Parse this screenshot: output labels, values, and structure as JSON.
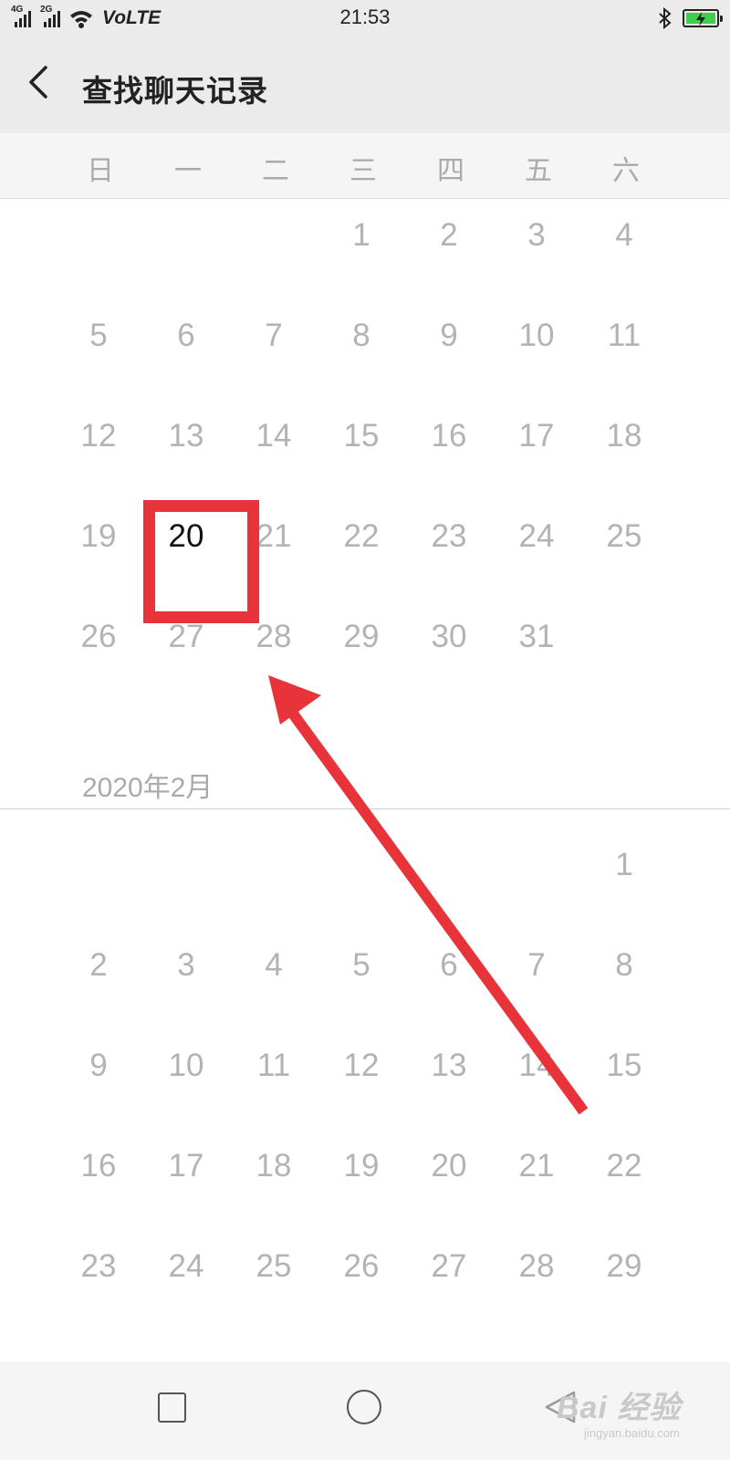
{
  "status_bar": {
    "network_1": "4G",
    "network_2": "2G",
    "volte": "VoLTE",
    "time": "21:53",
    "icons": [
      "signal-icon",
      "wifi-icon",
      "bluetooth-icon",
      "battery-charging-icon"
    ],
    "battery_color": "#3ecf4b"
  },
  "header": {
    "back_icon": "chevron-left-icon",
    "title": "查找聊天记录"
  },
  "weekdays": [
    "日",
    "一",
    "二",
    "三",
    "四",
    "五",
    "六"
  ],
  "calendar": {
    "month1": {
      "days": [
        "1",
        "2",
        "3",
        "4",
        "5",
        "6",
        "7",
        "8",
        "9",
        "10",
        "11",
        "12",
        "13",
        "14",
        "15",
        "16",
        "17",
        "18",
        "19",
        "20",
        "21",
        "22",
        "23",
        "24",
        "25",
        "26",
        "27",
        "28",
        "29",
        "30",
        "31"
      ],
      "selected_day": "20"
    },
    "month2": {
      "label": "2020年2月",
      "days": [
        "1",
        "2",
        "3",
        "4",
        "5",
        "6",
        "7",
        "8",
        "9",
        "10",
        "11",
        "12",
        "13",
        "14",
        "15",
        "16",
        "17",
        "18",
        "19",
        "20",
        "21",
        "22",
        "23",
        "24",
        "25",
        "26",
        "27",
        "28",
        "29"
      ]
    }
  },
  "annotation": {
    "color": "#e8333a",
    "shapes": [
      "highlight-box",
      "arrow"
    ]
  },
  "nav_bar": {
    "icons": [
      "recent-apps-icon",
      "home-icon",
      "back-triangle-icon"
    ]
  },
  "watermark": {
    "main": "Bai  经验",
    "sub": "jingyan.baidu.com"
  }
}
